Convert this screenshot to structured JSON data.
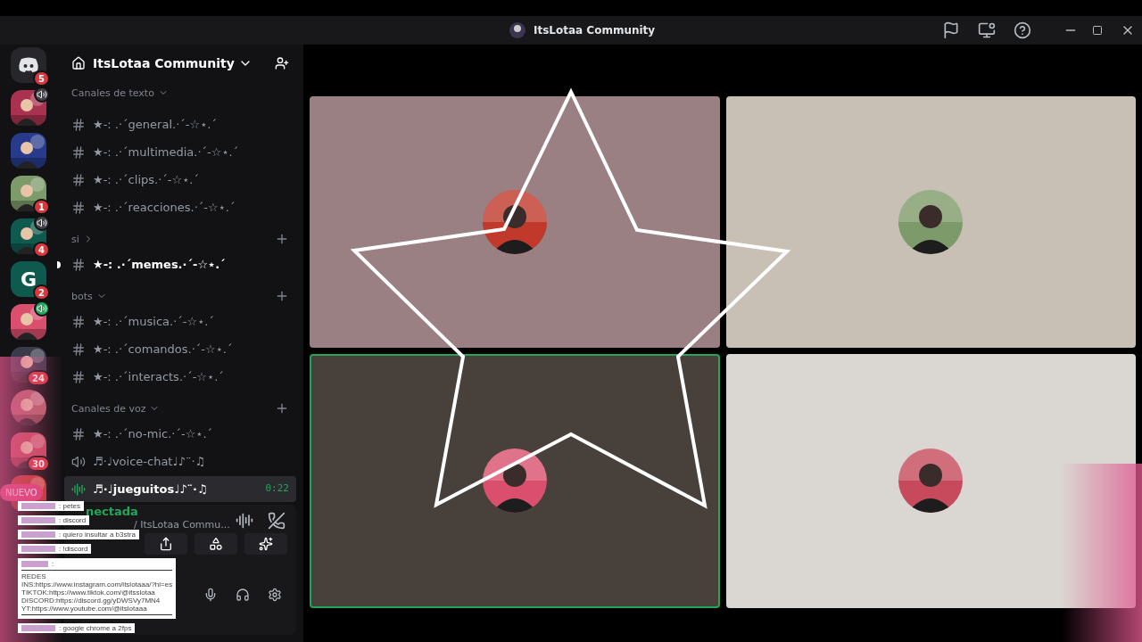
{
  "window": {
    "title": "ItsLotaa Community"
  },
  "servers": [
    {
      "kind": "home",
      "badge": "5"
    },
    {
      "kind": "picture",
      "speaker_live": false
    },
    {
      "kind": "picture"
    },
    {
      "kind": "picture",
      "badge": "1"
    },
    {
      "kind": "picture",
      "badge": "4",
      "speaker_live": false
    },
    {
      "kind": "letter",
      "badge": "2",
      "label": "G"
    },
    {
      "kind": "picture",
      "speaker_live": true
    },
    {
      "kind": "picture",
      "badge": "24"
    },
    {
      "kind": "picture"
    },
    {
      "kind": "picture",
      "badge": "30"
    },
    {
      "kind": "picture",
      "tag": "NUEVO"
    }
  ],
  "server_name": "ItsLotaa Community",
  "sections": [
    {
      "title": "Canales de texto",
      "expanded": true,
      "channels": [
        {
          "kind": "text",
          "name": "★-: .·ˊgeneral.·ˊ-☆⋆.ˊ",
          "selected": false,
          "unread": false
        },
        {
          "kind": "text",
          "name": "★-: .·ˊmultimedia.·ˊ-☆⋆.ˊ",
          "selected": false,
          "unread": false
        },
        {
          "kind": "text",
          "name": "★-: .·ˊclips.·ˊ-☆⋆.ˊ",
          "selected": false,
          "unread": false
        },
        {
          "kind": "text",
          "name": "★-: .·ˊreacciones.·ˊ-☆⋆.ˊ",
          "selected": false,
          "unread": false
        }
      ]
    },
    {
      "title": "si",
      "expanded": false,
      "channels": [
        {
          "kind": "text",
          "name": "★-: .·ˊmemes.·ˊ-☆⋆.ˊ",
          "selected": false,
          "unread": true
        }
      ]
    },
    {
      "title": "bots",
      "expanded": true,
      "channels": [
        {
          "kind": "text",
          "name": "★-: .·ˊmusica.·ˊ-☆⋆.ˊ",
          "selected": false,
          "unread": false
        },
        {
          "kind": "text",
          "name": "★-: .·ˊcomandos.·ˊ-☆⋆.ˊ",
          "selected": false,
          "unread": false
        },
        {
          "kind": "text",
          "name": "★-: .·ˊinteracts.·ˊ-☆⋆.ˊ",
          "selected": false,
          "unread": false
        }
      ]
    },
    {
      "title": "Canales de voz",
      "expanded": true,
      "channels": [
        {
          "kind": "text",
          "name": "★-: .·ˊno-mic.·ˊ-☆⋆.ˊ",
          "selected": false,
          "unread": false
        },
        {
          "kind": "voice",
          "name": "♬·♩voice-chat♩♪¨·♫",
          "selected": false,
          "unread": false
        },
        {
          "kind": "live",
          "name": "♬·♩jueguitos♩♪¨·♫",
          "selected": true,
          "unread": false,
          "timer": "0:22"
        }
      ]
    }
  ],
  "voice_panel": {
    "status": "nectada",
    "channel": "/ ItsLotaa Commu..."
  },
  "chat": [
    {
      "kind": "line",
      "text": ": petes"
    },
    {
      "kind": "line",
      "text": ": discord"
    },
    {
      "kind": "line",
      "text": ": quiero insultar a b3stra"
    },
    {
      "kind": "line",
      "text": ": !discord"
    },
    {
      "kind": "card",
      "text": ":",
      "lines": [
        "REDES",
        "INS:https://www.instagram.com/itslotaaa/?hl=es",
        "TIKTOK:https://www.tiktok.com/@itsslotaa",
        "DISCORD:https://discord.gg/yDWSVy7MN4",
        "YT:https://www.youtube.com/@itslotaaa"
      ]
    },
    {
      "kind": "line",
      "text": ": google chrome a 2fps"
    }
  ],
  "tiles": [
    {
      "color": "#9a7f83",
      "speaking": false
    },
    {
      "color": "#c8bfb5",
      "speaking": false
    },
    {
      "color": "#47403b",
      "speaking": true
    },
    {
      "color": "#dad6d2",
      "speaking": false
    }
  ]
}
